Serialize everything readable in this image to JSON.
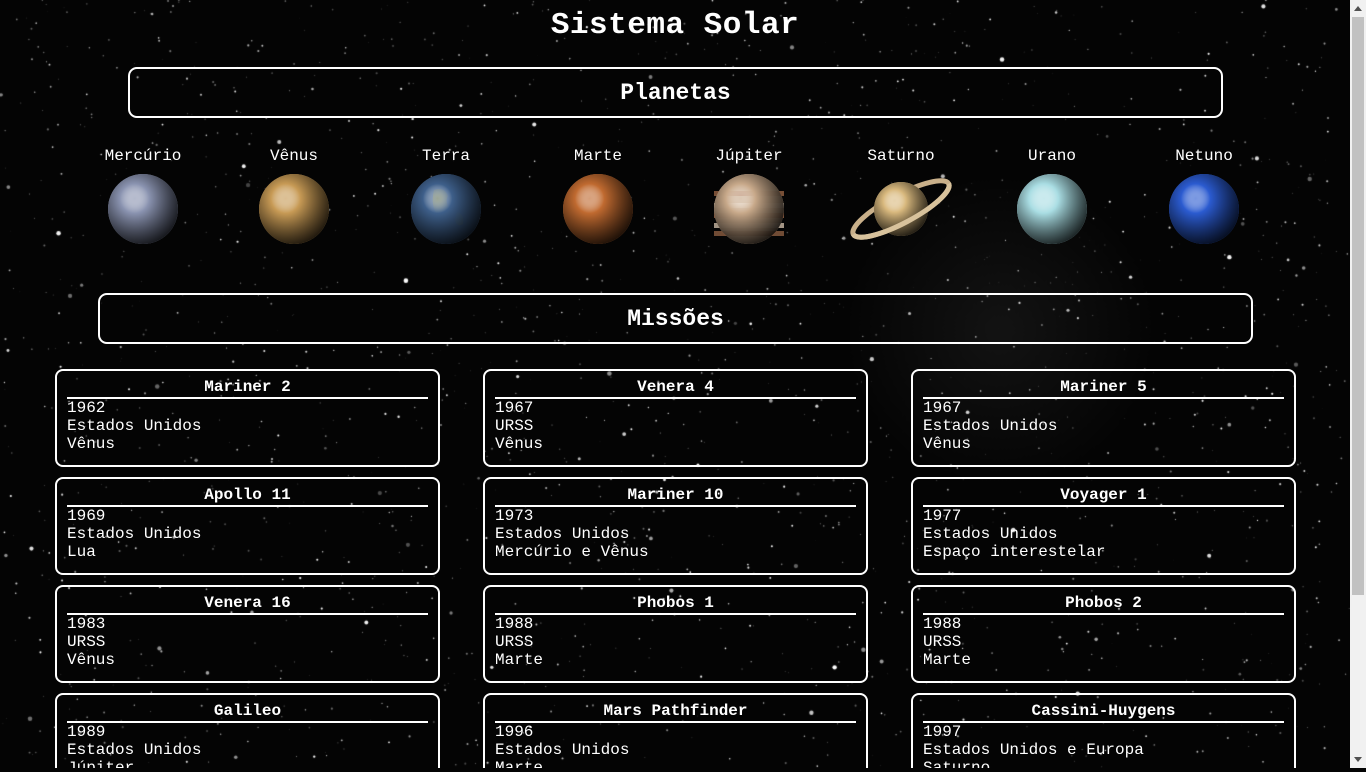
{
  "title": "Sistema Solar",
  "sections": {
    "planets": "Planetas",
    "missions": "Missões"
  },
  "planets": [
    {
      "name": "Mercúrio",
      "icon": "mercury-icon",
      "color": "#8a93b0"
    },
    {
      "name": "Vênus",
      "icon": "venus-icon",
      "color": "#c79a55"
    },
    {
      "name": "Terra",
      "icon": "earth-icon",
      "color": "#3e5f8a"
    },
    {
      "name": "Marte",
      "icon": "mars-icon",
      "color": "#c06a30"
    },
    {
      "name": "Júpiter",
      "icon": "jupiter-icon",
      "color": "#c8a98a"
    },
    {
      "name": "Saturno",
      "icon": "saturn-icon",
      "color": "#d9b97e"
    },
    {
      "name": "Urano",
      "icon": "uranus-icon",
      "color": "#a9dde3"
    },
    {
      "name": "Netuno",
      "icon": "neptune-icon",
      "color": "#2b5bd0"
    }
  ],
  "missions": [
    {
      "name": "Mariner 2",
      "year": "1962",
      "country": "Estados Unidos",
      "target": "Vênus"
    },
    {
      "name": "Venera 4",
      "year": "1967",
      "country": "URSS",
      "target": "Vênus"
    },
    {
      "name": "Mariner 5",
      "year": "1967",
      "country": "Estados Unidos",
      "target": "Vênus"
    },
    {
      "name": "Apollo 11",
      "year": "1969",
      "country": "Estados Unidos",
      "target": "Lua"
    },
    {
      "name": "Mariner 10",
      "year": "1973",
      "country": "Estados Unidos",
      "target": "Mercúrio e Vênus"
    },
    {
      "name": "Voyager 1",
      "year": "1977",
      "country": "Estados Unidos",
      "target": "Espaço interestelar"
    },
    {
      "name": "Venera 16",
      "year": "1983",
      "country": "URSS",
      "target": "Vênus"
    },
    {
      "name": "Phobos 1",
      "year": "1988",
      "country": "URSS",
      "target": "Marte"
    },
    {
      "name": "Phobos 2",
      "year": "1988",
      "country": "URSS",
      "target": "Marte"
    },
    {
      "name": "Galileo",
      "year": "1989",
      "country": "Estados Unidos",
      "target": "Júpiter"
    },
    {
      "name": "Mars Pathfinder",
      "year": "1996",
      "country": "Estados Unidos",
      "target": "Marte"
    },
    {
      "name": "Cassini-Huygens",
      "year": "1997",
      "country": "Estados Unidos e Europa",
      "target": "Saturno"
    }
  ],
  "colors": {
    "background": "#040404",
    "text": "#ffffff",
    "border": "#ffffff"
  }
}
